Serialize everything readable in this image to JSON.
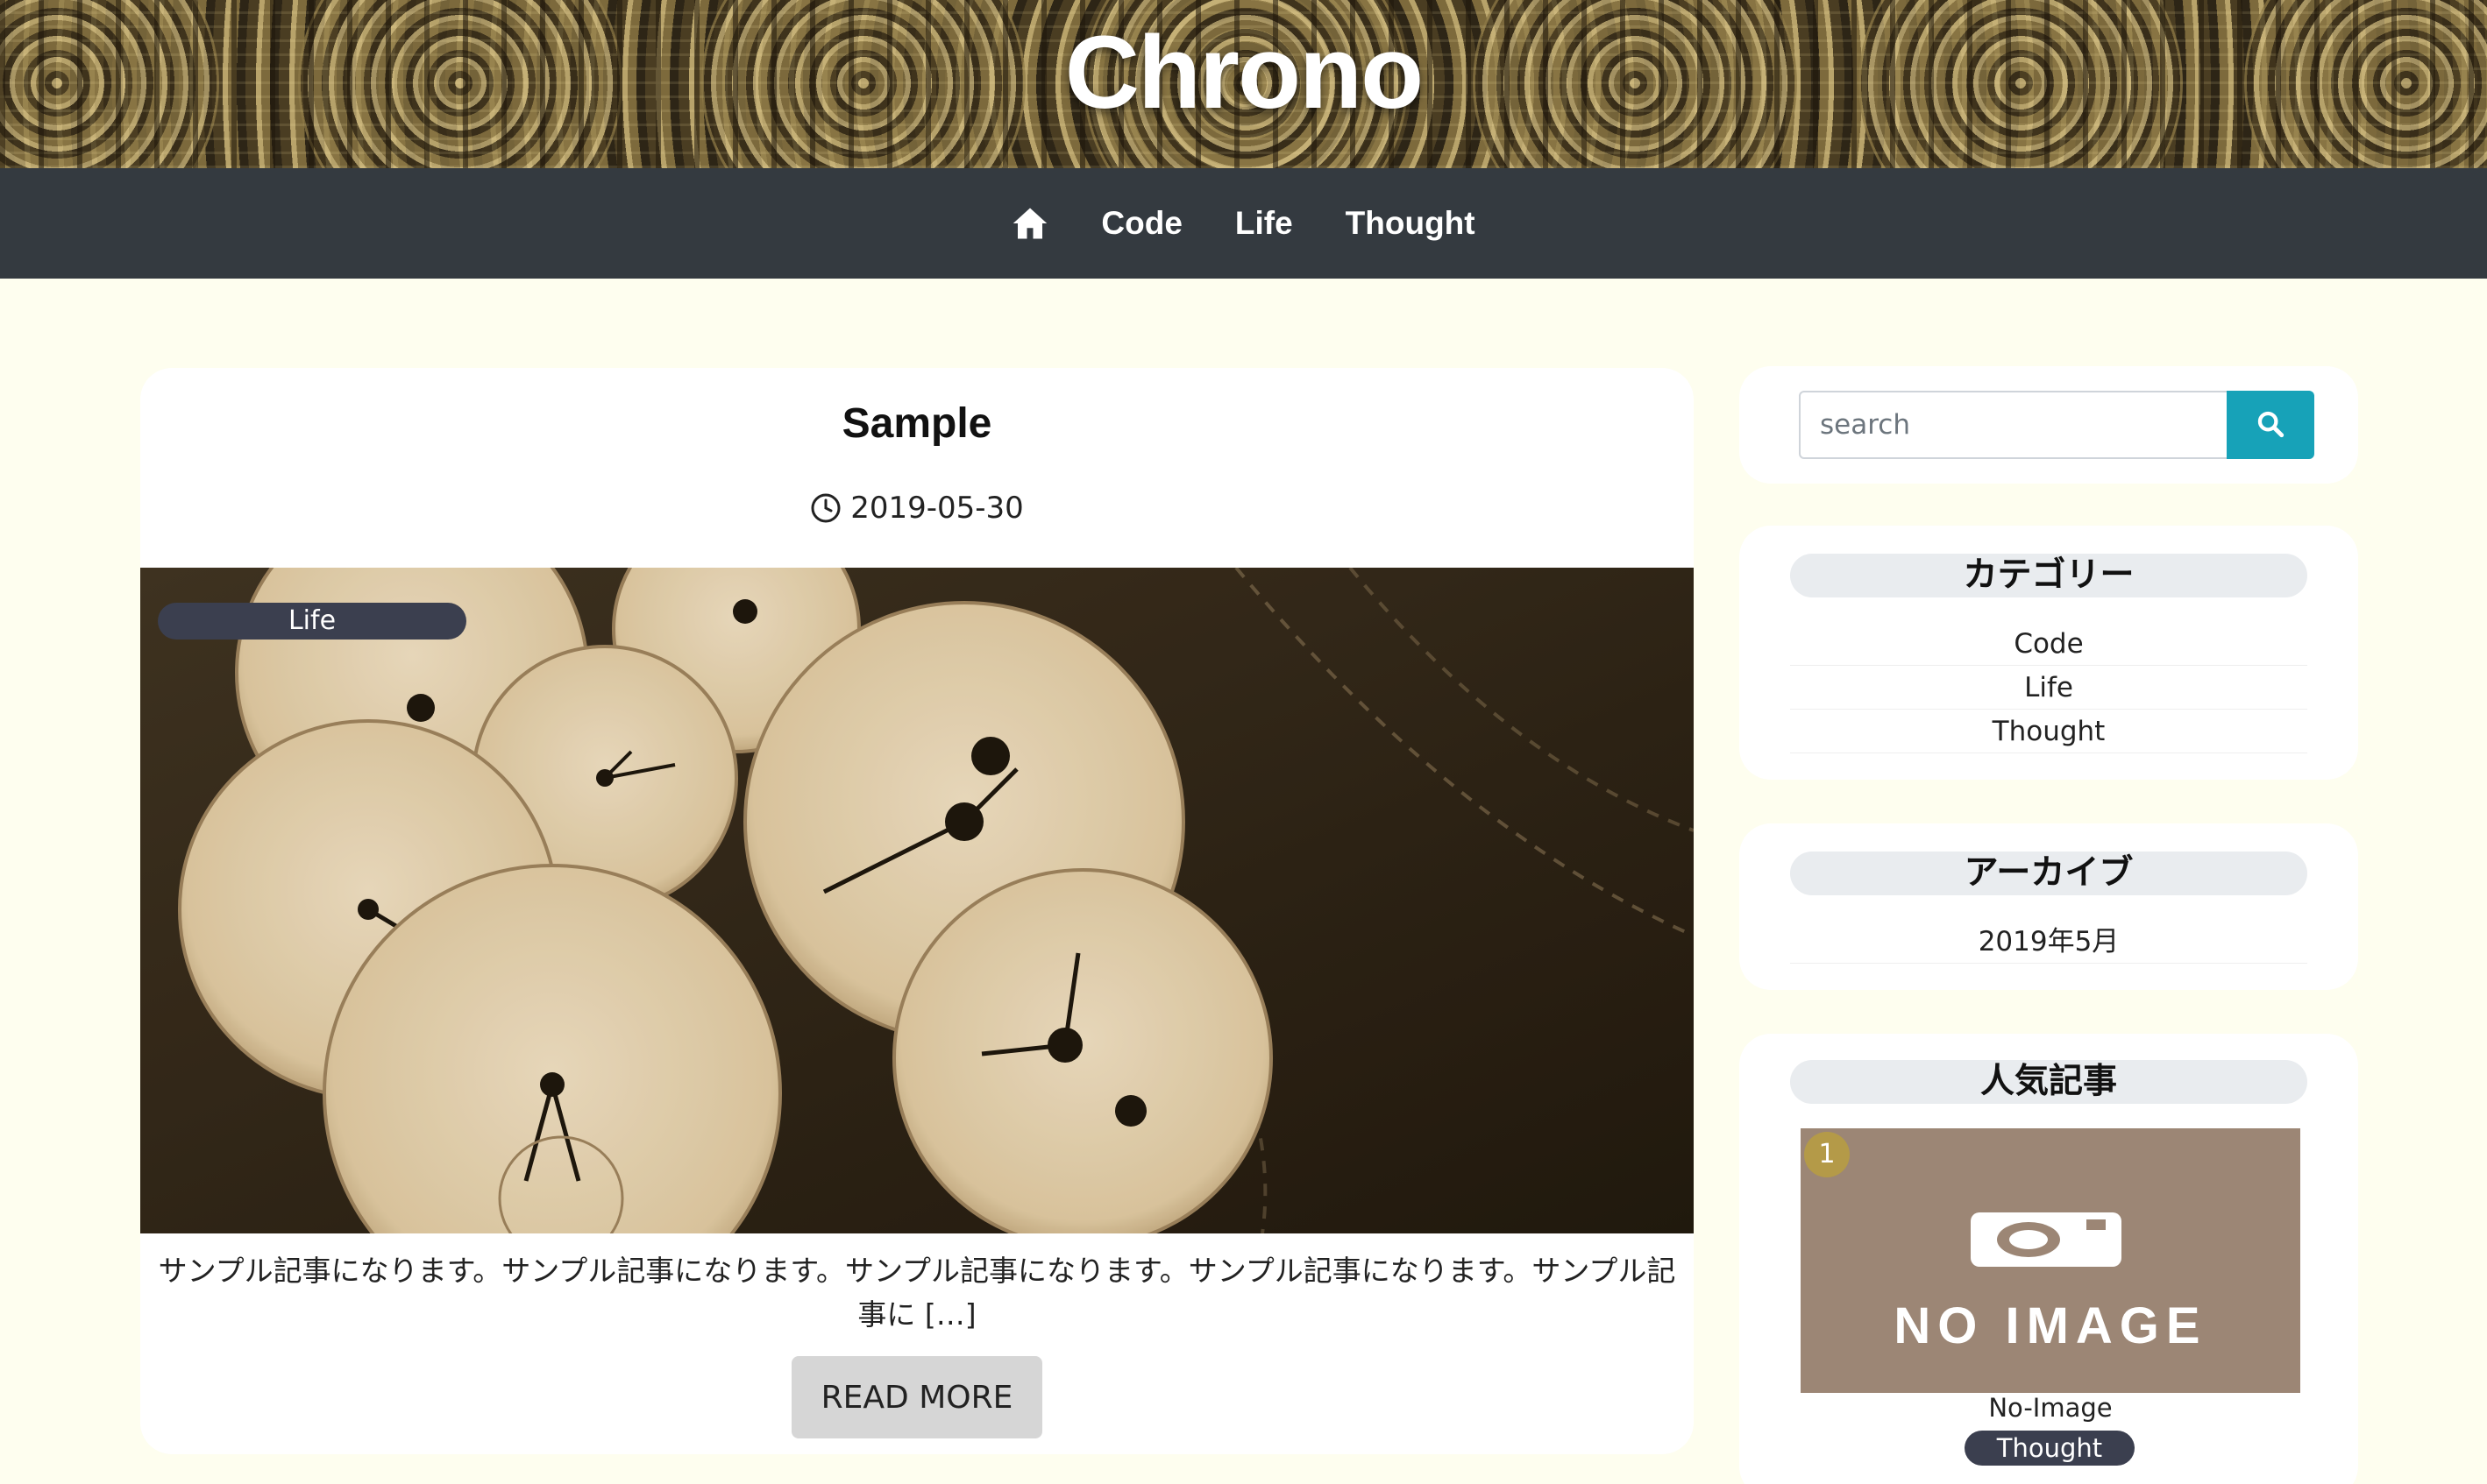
{
  "site": {
    "title": "Chrono"
  },
  "nav": {
    "home_icon": "home-icon",
    "items": [
      {
        "label": "Code"
      },
      {
        "label": "Life"
      },
      {
        "label": "Thought"
      }
    ]
  },
  "post": {
    "title": "Sample",
    "date": "2019-05-30",
    "category": "Life",
    "excerpt": "サンプル記事になります。サンプル記事になります。サンプル記事になります。サンプル記事になります。サンプル記事に […]",
    "read_more_label": "READ MORE"
  },
  "search": {
    "placeholder": "search",
    "icon": "search-icon"
  },
  "categories": {
    "heading": "カテゴリー",
    "items": [
      {
        "label": "Code"
      },
      {
        "label": "Life"
      },
      {
        "label": "Thought"
      }
    ]
  },
  "archive": {
    "heading": "アーカイブ",
    "items": [
      {
        "label": "2019年5月"
      }
    ]
  },
  "popular": {
    "heading": "人気記事",
    "items": [
      {
        "rank": "1",
        "image_text": "NO IMAGE",
        "title": "No-Image",
        "category": "Thought"
      }
    ]
  },
  "colors": {
    "page_background": "#fefeef",
    "navbar": "#343a40",
    "search_button": "#17a2b8",
    "badge": "#3b3f4f",
    "rank_badge": "#b49a48",
    "noimage_background": "#9c8675"
  }
}
